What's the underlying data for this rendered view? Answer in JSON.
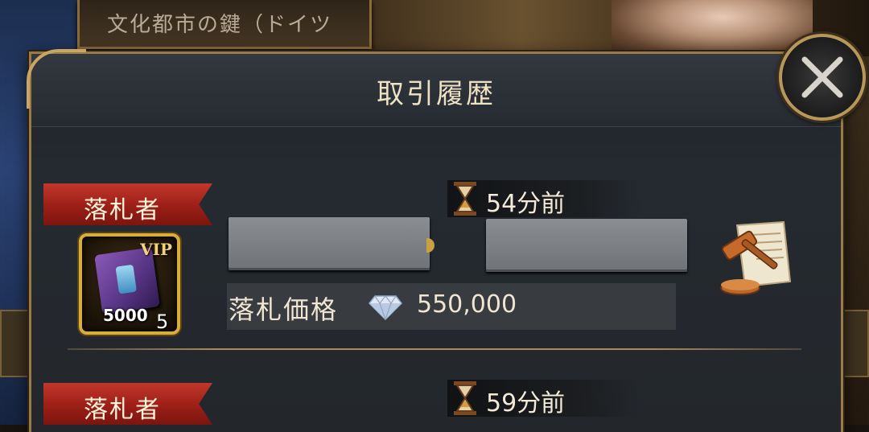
{
  "background": {
    "banner_text": "文化都市の鍵（ドイツ"
  },
  "dialog": {
    "title": "取引履歴",
    "close_icon": "close-x-icon"
  },
  "colors": {
    "ribbon_red": "#9b1f17",
    "gold_border": "#9a7b45",
    "panel_dark": "#23272c"
  },
  "records": [
    {
      "ribbon_label": "落札者",
      "time": "54分前",
      "item": {
        "badge": "VIP",
        "quantity": "5000",
        "count": "5"
      },
      "price_label": "落札価格",
      "price_value": "550,000",
      "currency_icon": "diamond-icon",
      "action_icon": "auction-gavel-icon"
    },
    {
      "ribbon_label": "落札者",
      "time": "59分前"
    }
  ]
}
